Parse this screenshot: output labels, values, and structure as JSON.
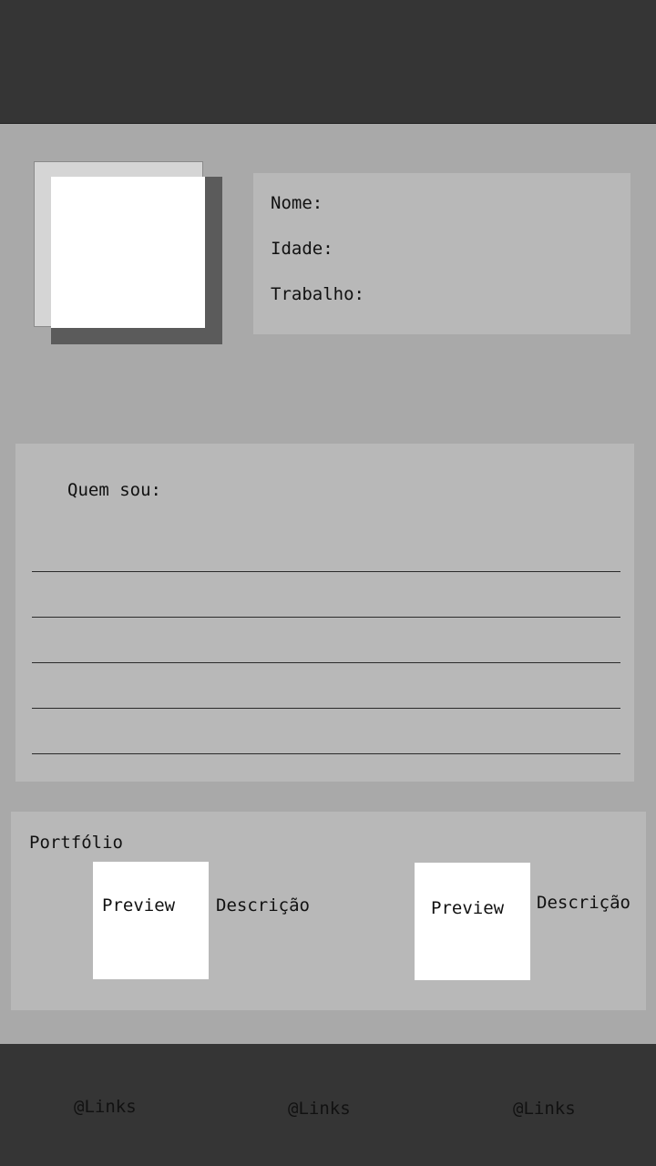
{
  "profile": {
    "name_label": "Nome:",
    "age_label": "Idade:",
    "job_label": "Trabalho:"
  },
  "about": {
    "title": "Quem sou:"
  },
  "portfolio": {
    "title": "Portfólio",
    "items": [
      {
        "preview_label": "Preview",
        "description": "Descrição"
      },
      {
        "preview_label": "Preview",
        "description": "Descrição"
      }
    ]
  },
  "footer": {
    "links": [
      "@Links",
      "@Links",
      "@Links"
    ]
  }
}
